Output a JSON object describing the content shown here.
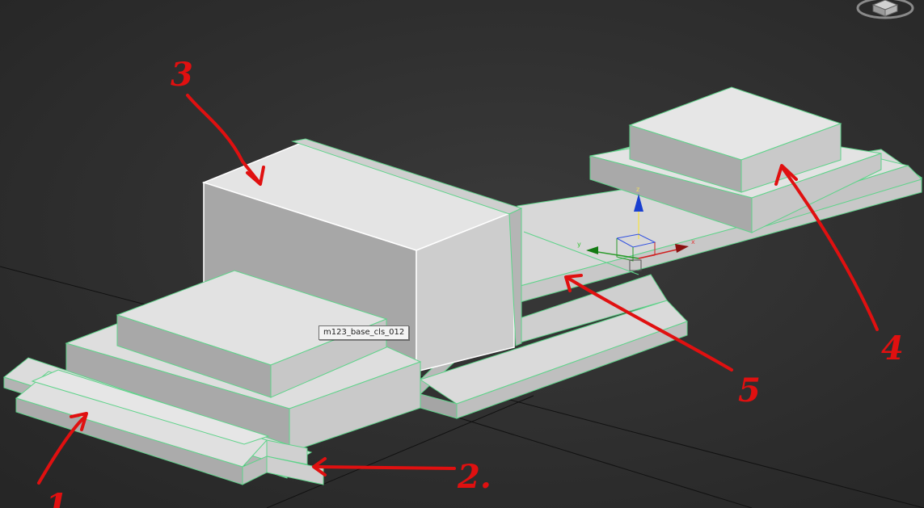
{
  "viewport": {
    "background": "#2b2b2b",
    "edge_color": "#5fd38a",
    "object_fill": "#d7d7d7",
    "annotation_color": "#e01010"
  },
  "tooltip": {
    "object_name": "m123_base_cls_012"
  },
  "gizmo": {
    "x_label": "x",
    "y_label": "y",
    "z_label": "z"
  },
  "annotations": {
    "label_1": "1",
    "label_2": "2.",
    "label_3": "3",
    "label_4": "4",
    "label_5": "5"
  },
  "icons": [
    "viewcube-icon",
    "transform-gizmo-icon"
  ]
}
